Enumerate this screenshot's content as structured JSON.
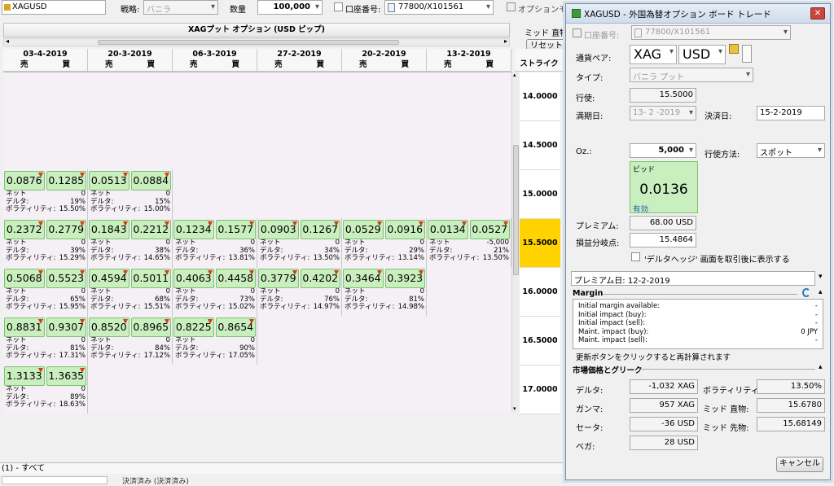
{
  "top": {
    "symbol": "XAGUSD",
    "strategy_label": "戦略:",
    "strategy_value": "バニラ",
    "qty_label": "数量",
    "qty_value": "100,000",
    "account_label": "口座番号:",
    "account_value": "77800/X101561",
    "option_module_label": "オプションモジュ"
  },
  "board": {
    "title": "XAGプット オプション (USD ピップ)",
    "mid_label": "ミッド 直物",
    "reset_label": "リセット",
    "strike_header": "ストライク",
    "sell": "売",
    "buy": "買",
    "dates": [
      "03-4-2019",
      "20-3-2019",
      "06-3-2019",
      "27-2-2019",
      "20-2-2019",
      "13-2-2019"
    ],
    "strikes": [
      "14.0000",
      "14.5000",
      "15.0000",
      "15.5000",
      "16.0000",
      "16.5000",
      "17.0000"
    ],
    "row_labels": {
      "net": "ネット",
      "delta": "デルタ:",
      "vol": "ボラティリティ:"
    },
    "rows": [
      [
        {
          "s": "0.0876",
          "b": "0.1285",
          "net": "0",
          "delta": "19%",
          "vol": "15.50%"
        },
        {
          "s": "0.0513",
          "b": "0.0884",
          "net": "0",
          "delta": "15%",
          "vol": "15.00%"
        }
      ],
      [
        {
          "s": "0.2372",
          "b": "0.2779",
          "net": "0",
          "delta": "39%",
          "vol": "15.29%"
        },
        {
          "s": "0.1843",
          "b": "0.2212",
          "net": "0",
          "delta": "38%",
          "vol": "14.65%"
        },
        {
          "s": "0.1234",
          "b": "0.1577",
          "net": "0",
          "delta": "36%",
          "vol": "13.81%"
        },
        {
          "s": "0.0903",
          "b": "0.1267",
          "net": "0",
          "delta": "34%",
          "vol": "13.50%"
        },
        {
          "s": "0.0529",
          "b": "0.0916",
          "net": "0",
          "delta": "29%",
          "vol": "13.14%"
        },
        {
          "s": "0.0134",
          "b": "0.0527",
          "net": "-5,000",
          "delta": "21%",
          "vol": "13.50%"
        }
      ],
      [
        {
          "s": "0.5068",
          "b": "0.5523",
          "net": "0",
          "delta": "65%",
          "vol": "15.95%"
        },
        {
          "s": "0.4594",
          "b": "0.5011",
          "net": "0",
          "delta": "68%",
          "vol": "15.51%"
        },
        {
          "s": "0.4063",
          "b": "0.4458",
          "net": "0",
          "delta": "73%",
          "vol": "15.02%"
        },
        {
          "s": "0.3779",
          "b": "0.4202",
          "net": "0",
          "delta": "76%",
          "vol": "14.97%"
        },
        {
          "s": "0.3464",
          "b": "0.3923",
          "net": "0",
          "delta": "81%",
          "vol": "14.98%"
        }
      ],
      [
        {
          "s": "0.8831",
          "b": "0.9307",
          "net": "0",
          "delta": "81%",
          "vol": "17.31%"
        },
        {
          "s": "0.8520",
          "b": "0.8965",
          "net": "0",
          "delta": "84%",
          "vol": "17.12%"
        },
        {
          "s": "0.8225",
          "b": "0.8654",
          "net": "0",
          "delta": "90%",
          "vol": "17.05%"
        }
      ],
      [
        {
          "s": "1.3133",
          "b": "1.3635",
          "net": "0",
          "delta": "89%",
          "vol": "18.63%"
        }
      ]
    ]
  },
  "bottom": {
    "filter": "(1) - すべて",
    "extra": "決済済み  (決済済み)"
  },
  "dialog": {
    "title": "XAGUSD - 外国為替オプション ボード トレード",
    "account_label": "口座番号:",
    "account_value": "77800/X101561",
    "pair_label": "通貨ペア:",
    "base": "XAG",
    "quote": "USD",
    "type_label": "タイプ:",
    "type_value": "バニラ プット",
    "strike_label": "行使:",
    "strike_value": "15.5000",
    "expiry_label": "満期日:",
    "expiry_value": "13- 2 -2019",
    "settle_label": "決済日:",
    "settle_value": "15-2-2019",
    "oz_label": "Oz.:",
    "oz_value": "5,000",
    "method_label": "行使方法:",
    "method_value": "スポット",
    "bid_label": "ビッド",
    "bid_value": "0.0136",
    "bid_status": "有効",
    "premium_label": "プレミアム:",
    "premium_value": "68.00 USD",
    "breakeven_label": "損益分岐点:",
    "breakeven_value": "15.4864",
    "delta_hedge_label": "'デルタヘッジ' 画面を取引後に表示する",
    "premium_date": "プレミアム日: 12-2-2019",
    "margin_title": "Margin",
    "margin_rows": [
      {
        "k": "Initial margin available:",
        "v": "-"
      },
      {
        "k": "Initial impact (buy):",
        "v": "-"
      },
      {
        "k": "Initial impact (sell):",
        "v": "-"
      },
      {
        "k": "Maint. impact (buy):",
        "v": "0 JPY"
      },
      {
        "k": "Maint. impact (sell):",
        "v": "-"
      }
    ],
    "refresh_note": "更新ボタンをクリックすると再計算されます",
    "greeks_title": "市場価格とグリーク",
    "delta_label": "デルタ:",
    "delta_value": "-1,032 XAG",
    "vol_label": "ボラティリティ:",
    "vol_value": "13.50%",
    "gamma_label": "ガンマ:",
    "gamma_value": "957 XAG",
    "mid_spot_label": "ミッド 直物:",
    "mid_spot_value": "15.6780",
    "theta_label": "セータ:",
    "theta_value": "-36 USD",
    "mid_fwd_label": "ミッド 先物:",
    "mid_fwd_value": "15.68149",
    "vega_label": "ベガ:",
    "vega_value": "28 USD",
    "cancel_label": "キャンセル"
  }
}
